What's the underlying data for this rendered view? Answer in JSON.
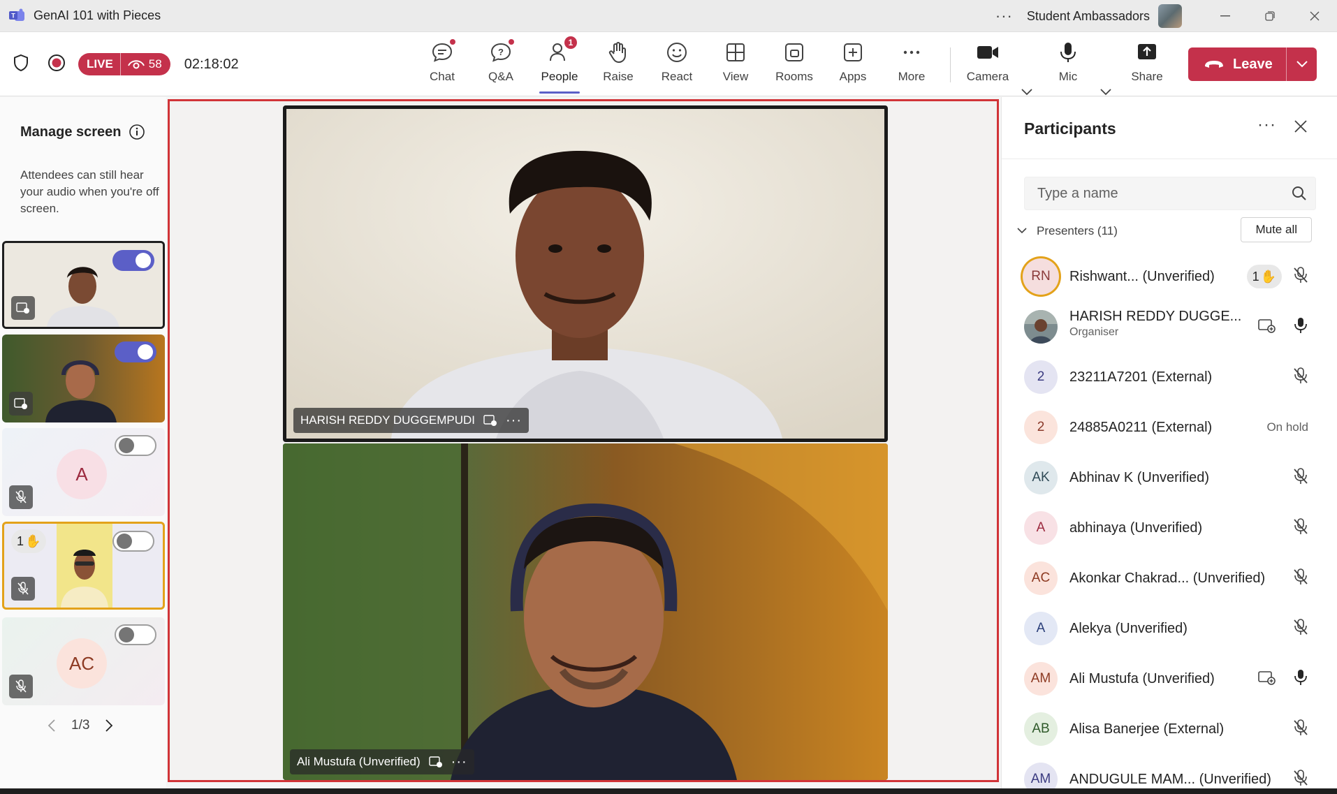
{
  "titlebar": {
    "app_title": "GenAI 101 with Pieces",
    "org_name": "Student Ambassadors"
  },
  "meeting_bar": {
    "live_label": "LIVE",
    "viewer_count": "58",
    "elapsed": "02:18:02",
    "tools": [
      {
        "key": "chat",
        "label": "Chat"
      },
      {
        "key": "qa",
        "label": "Q&A"
      },
      {
        "key": "people",
        "label": "People",
        "badge": "1"
      },
      {
        "key": "raise",
        "label": "Raise"
      },
      {
        "key": "react",
        "label": "React"
      },
      {
        "key": "view",
        "label": "View"
      },
      {
        "key": "rooms",
        "label": "Rooms"
      },
      {
        "key": "apps",
        "label": "Apps"
      },
      {
        "key": "more",
        "label": "More"
      },
      {
        "key": "camera",
        "label": "Camera"
      },
      {
        "key": "mic",
        "label": "Mic"
      },
      {
        "key": "share",
        "label": "Share"
      }
    ],
    "leave_label": "Leave"
  },
  "manage_screen": {
    "title": "Manage screen",
    "description": "Attendees can still hear your audio when you're off screen.",
    "thumbs": [
      {
        "kind": "video",
        "on_screen": true
      },
      {
        "kind": "video",
        "on_screen": true
      },
      {
        "kind": "avatar",
        "initials": "A",
        "on_screen": false
      },
      {
        "kind": "video",
        "hand_count": "1",
        "on_screen": false
      },
      {
        "kind": "avatar",
        "initials": "AC",
        "on_screen": false
      }
    ],
    "pager": "1/3"
  },
  "stage": {
    "videos": [
      {
        "name": "HARISH REDDY DUGGEMPUDI"
      },
      {
        "name": "Ali Mustufa (Unverified)"
      }
    ]
  },
  "participants": {
    "title": "Participants",
    "search_placeholder": "Type a name",
    "section_label": "Presenters (11)",
    "mute_all_label": "Mute all",
    "people": [
      {
        "initials": "RN",
        "name": "Rishwant...  (Unverified)",
        "hand_count": "1",
        "mic": "muted",
        "avatar_bg": "#f5dede",
        "avatar_fg": "#8a3a3a"
      },
      {
        "initials": "",
        "name": "HARISH REDDY DUGGE...",
        "role": "Organiser",
        "share": true,
        "mic": "on",
        "photo": true
      },
      {
        "initials": "2",
        "name": "23211A7201 (External)",
        "mic": "muted",
        "avatar_bg": "#e4e4f2",
        "avatar_fg": "#3b3b80"
      },
      {
        "initials": "2",
        "name": "24885A0211 (External)",
        "status": "On hold",
        "avatar_bg": "#fbe4dc",
        "avatar_fg": "#8a3a2a"
      },
      {
        "initials": "AK",
        "name": "Abhinav K (Unverified)",
        "mic": "muted",
        "avatar_bg": "#dfe8ec",
        "avatar_fg": "#2f4a56"
      },
      {
        "initials": "A",
        "name": "abhinaya (Unverified)",
        "mic": "muted",
        "avatar_bg": "#f8e1e5",
        "avatar_fg": "#9c2a3f"
      },
      {
        "initials": "AC",
        "name": "Akonkar Chakrad...  (Unverified)",
        "mic": "muted",
        "avatar_bg": "#fbe3dc",
        "avatar_fg": "#8d3a22"
      },
      {
        "initials": "A",
        "name": "Alekya (Unverified)",
        "mic": "muted",
        "avatar_bg": "#e3e8f5",
        "avatar_fg": "#2b3f7a"
      },
      {
        "initials": "AM",
        "name": "Ali Mustufa (Unverified)",
        "share": true,
        "mic": "on",
        "avatar_bg": "#fbe3dc",
        "avatar_fg": "#8d3a22"
      },
      {
        "initials": "AB",
        "name": "Alisa Banerjee (External)",
        "mic": "muted",
        "avatar_bg": "#e4efe0",
        "avatar_fg": "#2f5a2a"
      },
      {
        "initials": "AM",
        "name": "ANDUGULE MAM...  (Unverified)",
        "mic": "muted",
        "avatar_bg": "#e4e4f2",
        "avatar_fg": "#3b3b80"
      }
    ]
  },
  "colors": {
    "accent": "#5b5fc7",
    "leave": "#c4314b",
    "stage_border": "#d13438",
    "hand": "#e3a21a"
  }
}
